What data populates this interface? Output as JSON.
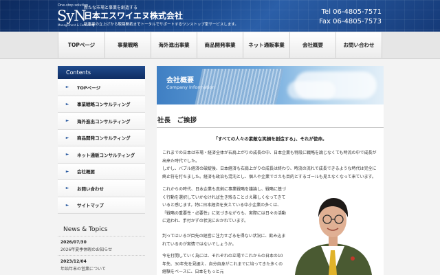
{
  "header": {
    "tagline_small": "One-stop solution",
    "logo_text": "SyN",
    "logo_sub": "Management & Consulting",
    "company_tag": "新たな市場と事業を創造する",
    "company_name": "日本エスワイエヌ株式会社",
    "company_desc": "新事業の立上げから販路開拓までトータルでサポートするワンストップ型サービスします。",
    "phone": "Tel 06-4805-7571",
    "fax": "Fax 06-4805-7573"
  },
  "nav": [
    {
      "label": "TOPページ"
    },
    {
      "label": "事業戦略"
    },
    {
      "label": "海外進出事業"
    },
    {
      "label": "商品開発事業"
    },
    {
      "label": "ネット通販事業"
    },
    {
      "label": "会社概要"
    },
    {
      "label": "お問い合わせ"
    }
  ],
  "sidebar": {
    "title": "Contents",
    "items": [
      {
        "label": "TOPページ"
      },
      {
        "label": "事業戦略コンサルティング"
      },
      {
        "label": "海外進出コンサルティング"
      },
      {
        "label": "商品開発コンサルティング"
      },
      {
        "label": "ネット通販コンサルティング"
      },
      {
        "label": "会社概要"
      },
      {
        "label": "お問い合わせ"
      },
      {
        "label": "サイトマップ"
      }
    ]
  },
  "news": {
    "title": "News & Topics",
    "items": [
      {
        "date": "2026/07/30",
        "text": "2026年夏季休暇のお知らせ"
      },
      {
        "date": "2023/12/04",
        "text": "年始年末の営業について"
      }
    ]
  },
  "main": {
    "banner_title": "会社概要",
    "banner_sub": "Company Information",
    "section_title": "社長　ご挨拶",
    "lead": "「すべての人々の素敵な笑顔を創造する」、それが使命。",
    "para1": "これまでの日本は市場・経済全体が右肩上がりの成長の中、日本企業も特段に戦略を論じなくても時流の中で成長が出来た時代でした。",
    "para2": "しかし、バブル経済の破綻後、日本経済も右肩上がりの成長は終わり、時流の流れで成長できるような時代は完全に終止符を打ちました。経済も政治も混沌とし、個人や企業でさえも目的とするゴールも見えなくなって来ています。",
    "para3": "これからの時代、日本企業も真剣に事業戦略を議論し、戦略に基づく行動を選択していかなければ生き残ることさえ難しくなってきていると感じます。特に日本経済を支えている中小企業の多くは、「戦略の重要性・必要性」に気づきながらも、実際には日々の活動に追われ、手付かずの状況におかれています。",
    "para4": "判ってはいるが目先の経営に注力せざるを得ない状況に、飲み込まれているのが実情ではないでしょうか。",
    "para5": "今を打開していく為には、それぞれの立場でこれからの日本の10年先、30年先を見据え、自分自身がこれまでに培ってきた多くの経験をベースに、日本をもっと元"
  }
}
